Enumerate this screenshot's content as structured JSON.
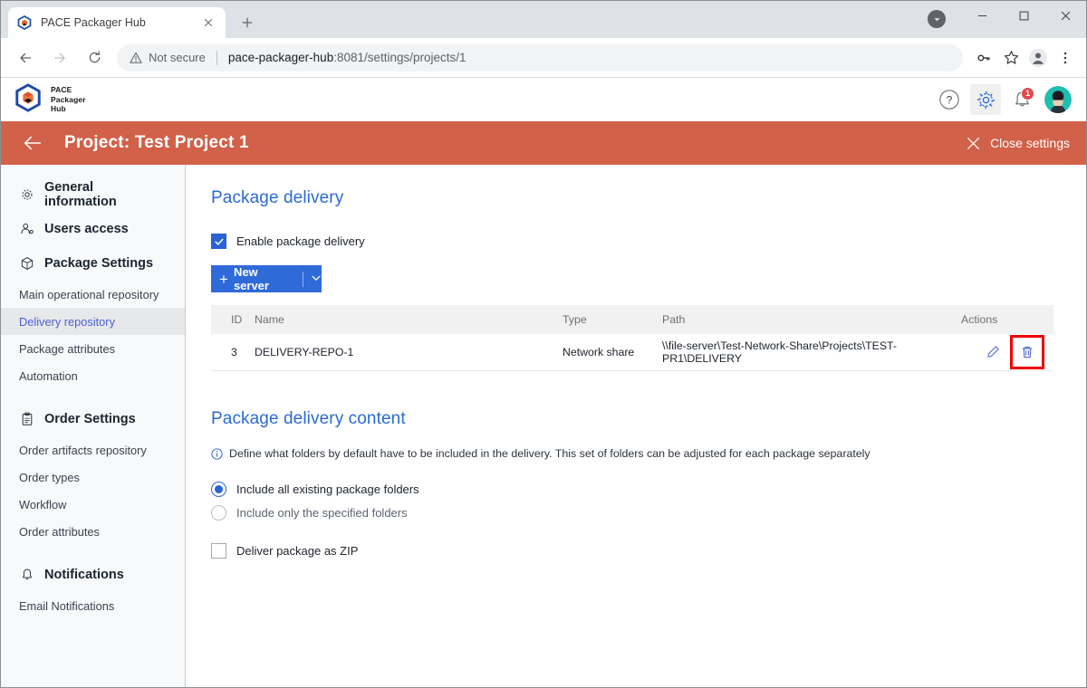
{
  "browser": {
    "tab": {
      "title": "PACE Packager Hub",
      "favicon_icon": "pace-cube-favicon",
      "close_icon": "close-icon"
    },
    "new_tab_icon": "plus-icon",
    "window_controls": {
      "caret_icon": "caret-down-icon",
      "minimize_icon": "minimize-icon",
      "maximize_icon": "maximize-icon",
      "close_icon": "close-icon"
    },
    "nav": {
      "back_icon": "back-arrow-icon",
      "forward_icon": "forward-arrow-icon",
      "reload_icon": "reload-icon"
    },
    "omnibox": {
      "security_icon": "not-secure-warning-icon",
      "security_label": "Not secure",
      "url_host": "pace-packager-hub",
      "url_path": ":8081/settings/projects/1"
    },
    "toolbar_icons": {
      "password_icon": "key-icon",
      "bookmark_icon": "star-icon",
      "profile_icon": "profile-avatar-icon",
      "menu_icon": "three-dot-menu-icon"
    }
  },
  "app_header": {
    "logo_icon": "pace-cube-logo",
    "brand_line1": "PACE",
    "brand_line2": "Packager",
    "brand_line3": "Hub",
    "help_icon": "help-question-icon",
    "settings_icon": "gear-icon",
    "notifications_icon": "bell-icon",
    "notifications_count": "1",
    "avatar_icon": "user-avatar"
  },
  "settings_bar": {
    "back_icon": "back-arrow-icon",
    "title": "Project: Test Project 1",
    "close_icon": "close-x-icon",
    "close_label": "Close settings",
    "background_color": "#d16149"
  },
  "sidebar": {
    "items": [
      {
        "label": "General information",
        "type": "group",
        "icon": "gear-icon"
      },
      {
        "label": "Users access",
        "type": "group",
        "icon": "users-icon"
      },
      {
        "label": "Package Settings",
        "type": "group",
        "icon": "package-cube-icon"
      },
      {
        "label": "Main operational repository",
        "type": "sub",
        "selected": false
      },
      {
        "label": "Delivery repository",
        "type": "sub",
        "selected": true
      },
      {
        "label": "Package attributes",
        "type": "sub",
        "selected": false
      },
      {
        "label": "Automation",
        "type": "sub",
        "selected": false
      },
      {
        "label": "Order Settings",
        "type": "group",
        "icon": "clipboard-icon"
      },
      {
        "label": "Order artifacts repository",
        "type": "sub",
        "selected": false
      },
      {
        "label": "Order types",
        "type": "sub",
        "selected": false
      },
      {
        "label": "Workflow",
        "type": "sub",
        "selected": false
      },
      {
        "label": "Order attributes",
        "type": "sub",
        "selected": false
      },
      {
        "label": "Notifications",
        "type": "group",
        "icon": "bell-icon"
      },
      {
        "label": "Email Notifications",
        "type": "sub",
        "selected": false
      }
    ]
  },
  "main": {
    "delivery_section": {
      "title": "Package delivery",
      "enable_checkbox": {
        "label": "Enable package delivery",
        "checked": true
      },
      "new_server_button": {
        "plus_icon": "plus-icon",
        "label": "New server",
        "dropdown_icon": "chevron-down-icon"
      },
      "table": {
        "columns": [
          "ID",
          "Name",
          "Type",
          "Path",
          "Actions"
        ],
        "rows": [
          {
            "id": "3",
            "name": "DELIVERY-REPO-1",
            "type": "Network share",
            "path": "\\\\file-server\\Test-Network-Share\\Projects\\TEST-PR1\\DELIVERY",
            "edit_icon": "pencil-edit-icon",
            "delete_icon": "trash-delete-icon",
            "delete_highlighted": true
          }
        ]
      }
    },
    "content_section": {
      "title": "Package delivery content",
      "hint_icon": "info-icon",
      "hint": "Define what folders by default have to be included in the delivery. This set of folders can be adjusted for each package separately",
      "radios": [
        {
          "label": "Include all existing package folders",
          "selected": true
        },
        {
          "label": "Include only the specified folders",
          "selected": false
        }
      ],
      "zip_checkbox": {
        "label": "Deliver package as ZIP",
        "checked": false
      }
    }
  },
  "colors": {
    "brand_orange": "#d16149",
    "accent_blue": "#2a6ad4",
    "button_blue": "#2f6ad9",
    "highlight_red": "#f00000",
    "link_blue": "#4a5ed8"
  }
}
